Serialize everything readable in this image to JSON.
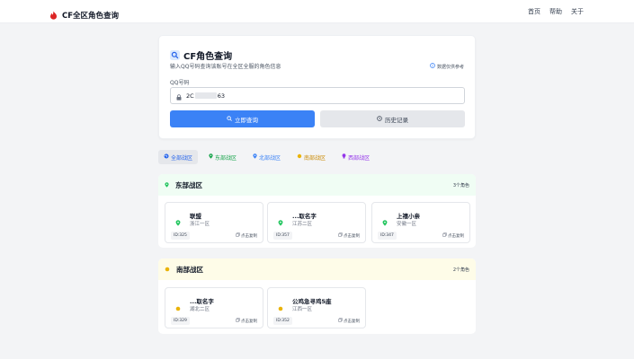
{
  "header": {
    "title": "CF全区角色查询",
    "nav": [
      "首页",
      "帮助",
      "关于"
    ]
  },
  "query": {
    "title": "CF角色查询",
    "subtitle": "输入QQ号码查询该账号在全区全服的角色信息",
    "note": "数据仅供参考",
    "qq_label": "QQ号码",
    "qq_value_start": "2C",
    "qq_value_end": "63",
    "search_button": "立即查询",
    "history_button": "历史记录"
  },
  "tabs": [
    {
      "label": "全部战区",
      "color": "#2563eb",
      "active": true
    },
    {
      "label": "东部战区",
      "color": "#16a34a",
      "active": false
    },
    {
      "label": "北部战区",
      "color": "#3b82f6",
      "active": false
    },
    {
      "label": "南部战区",
      "color": "#ca8a04",
      "active": false
    },
    {
      "label": "西部战区",
      "color": "#9333ea",
      "active": false
    }
  ],
  "regions": {
    "east": {
      "name": "东部战区",
      "count": "3个角色",
      "color": "#22c55e",
      "roles": [
        {
          "name": "联盟",
          "area": "浙江一区",
          "id": "ID:325",
          "copy": "点击复制"
        },
        {
          "name": "...取名字",
          "area": "江苏二区",
          "id": "ID:357",
          "copy": "点击复制"
        },
        {
          "name": "上禧小亲",
          "area": "安徽一区",
          "id": "ID:347",
          "copy": "点击复制"
        }
      ]
    },
    "south": {
      "name": "南部战区",
      "count": "2个角色",
      "color": "#eab308",
      "roles": [
        {
          "name": "...取名字",
          "area": "湖北二区",
          "id": "ID:329",
          "copy": "点击复制"
        },
        {
          "name": "公鸡急寻鸡5座",
          "area": "江西一区",
          "id": "ID:352",
          "copy": "点击复制"
        }
      ]
    }
  }
}
